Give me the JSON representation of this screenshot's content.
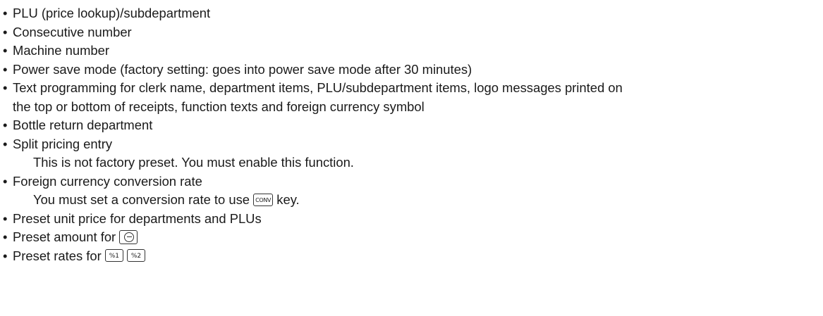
{
  "doc": {
    "bullet": "•",
    "items": [
      {
        "text": "PLU (price lookup)/subdepartment"
      },
      {
        "text": "Consecutive number"
      },
      {
        "text": "Machine number"
      },
      {
        "text": "Power save mode (factory setting: goes into power save mode after 30 minutes)"
      },
      {
        "text": "Text programming for clerk name, department items, PLU/subdepartment items, logo messages printed on",
        "continuation": "the top or bottom of receipts, function texts and foreign currency symbol"
      },
      {
        "text": "Bottle return department"
      },
      {
        "text": "Split pricing entry",
        "note": "This is not factory preset.  You must enable this function."
      },
      {
        "text": "Foreign currency conversion rate",
        "note_before": "You must set a conversion rate to use",
        "note_key": "CONV",
        "note_after": "key."
      },
      {
        "text": "Preset unit price for departments and PLUs"
      },
      {
        "text": "Preset amount for",
        "key": "minus-key"
      },
      {
        "text": "Preset rates for",
        "keys": [
          "%1",
          "%2"
        ]
      }
    ]
  },
  "icons": {
    "conv_key": "conv-key",
    "minus_key": "minus-key",
    "percent_keys": "percent-key"
  }
}
